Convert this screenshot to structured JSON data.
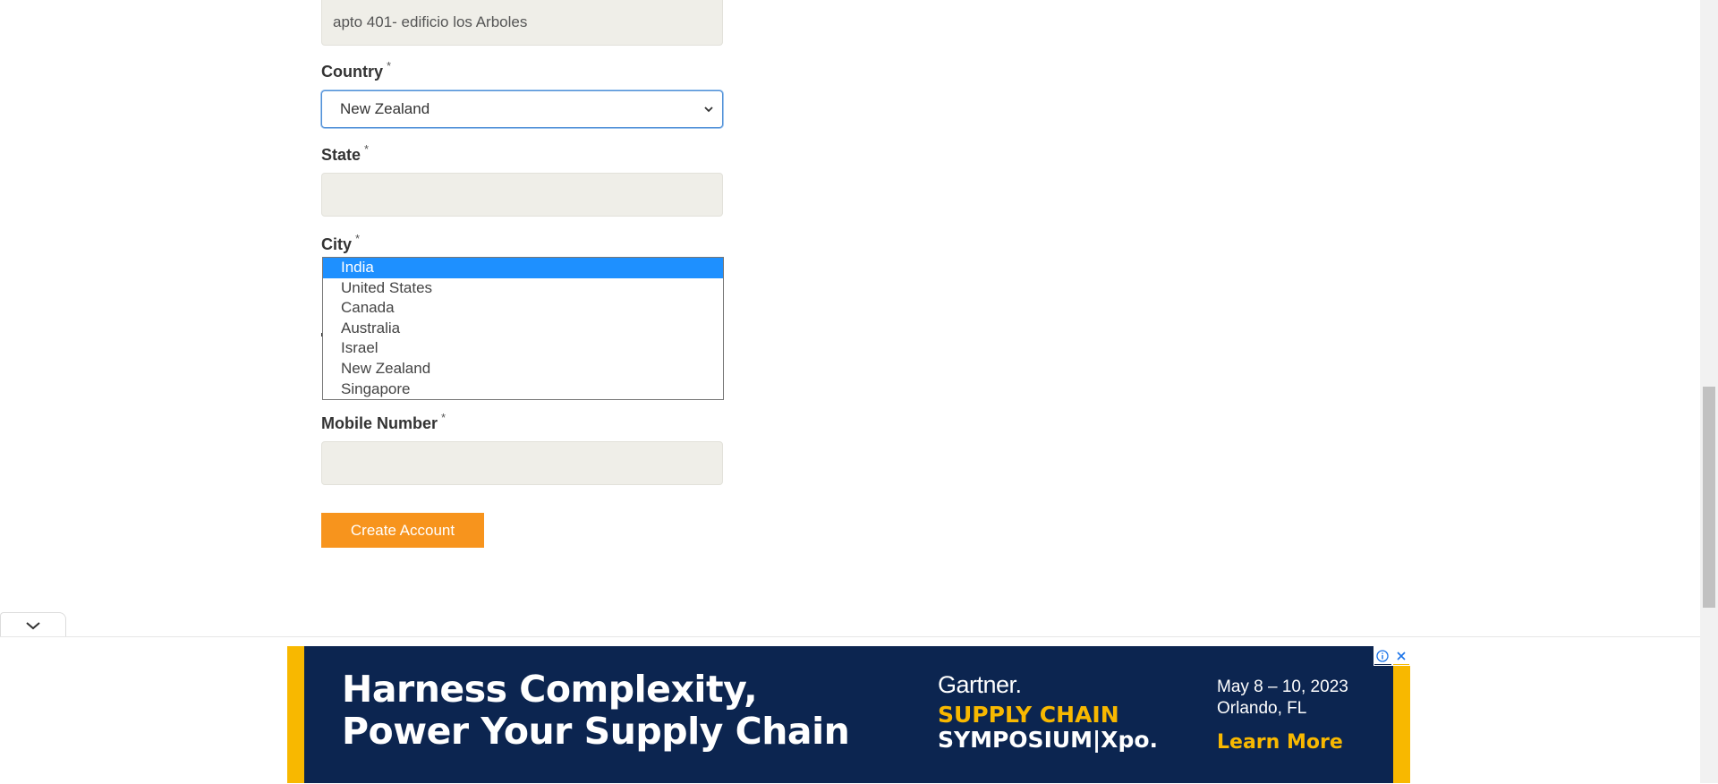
{
  "form": {
    "address2_value": "apto 401- edificio los Arboles",
    "country_label": "Country",
    "country_selected": "New Zealand",
    "state_label": "State",
    "state_value": "",
    "city_label": "City",
    "mobile_label": "Mobile Number",
    "mobile_value": "",
    "required_mark": "*",
    "submit_label": "Create Account"
  },
  "country_dropdown": {
    "options": [
      "India",
      "United States",
      "Canada",
      "Australia",
      "Israel",
      "New Zealand",
      "Singapore"
    ],
    "highlighted": "India"
  },
  "ad": {
    "headline_line1": "Harness Complexity,",
    "headline_line2": "Power Your Supply Chain",
    "brand": "Gartner.",
    "event_line1": "SUPPLY CHAIN",
    "event_line2": "SYMPOSIUM|Xpo.",
    "date": "May 8 – 10, 2023",
    "location": "Orlando, FL",
    "cta": "Learn More",
    "colors": {
      "background": "#0c2550",
      "accent": "#f8b800"
    }
  },
  "colors": {
    "button": "#f7941d",
    "input_bg": "#efeee8",
    "highlight": "#1e90ff"
  }
}
